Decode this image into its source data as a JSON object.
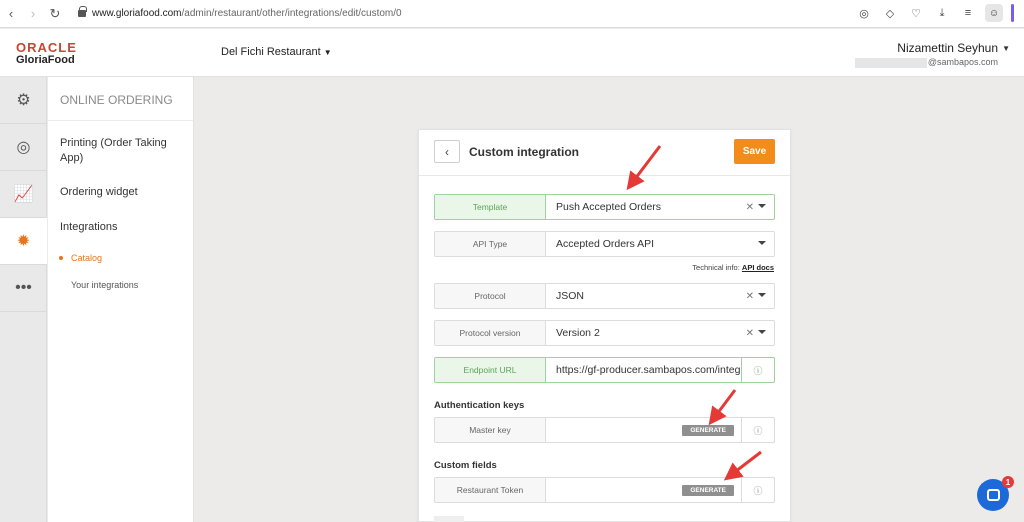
{
  "browser": {
    "url_domain": "www.gloriafood.com",
    "url_path": "/admin/restaurant/other/integrations/edit/custom/0"
  },
  "header": {
    "logo_top": "ORACLE",
    "logo_bottom": "GloriaFood",
    "restaurant": "Del Fichi Restaurant",
    "user_name": "Nizamettin Seyhun",
    "user_email": "@sambapos.com"
  },
  "rail": [
    "gears-icon",
    "target-icon",
    "chart-icon",
    "integrations-icon",
    "more-icon"
  ],
  "sidebar": {
    "heading": "ONLINE ORDERING",
    "printing": "Printing (Order Taking App)",
    "widget": "Ordering widget",
    "integrations": "Integrations",
    "catalog": "Catalog",
    "your_integrations": "Your integrations"
  },
  "panel": {
    "title": "Custom integration",
    "save": "Save",
    "template_label": "Template",
    "template_value": "Push Accepted Orders",
    "api_label": "API Type",
    "api_value": "Accepted Orders API",
    "tech_info": "Technical info:",
    "api_docs": "API docs",
    "protocol_label": "Protocol",
    "protocol_value": "JSON",
    "protver_label": "Protocol version",
    "protver_value": "Version 2",
    "endpoint_label": "Endpoint URL",
    "endpoint_value": "https://gf-producer.sambapos.com/integra",
    "auth_heading": "Authentication keys",
    "master_label": "Master key",
    "generate": "GENERATE",
    "custom_heading": "Custom fields",
    "token_label": "Restaurant Token"
  },
  "chat": {
    "badge": "1"
  },
  "colors": {
    "accent": "#f28c1a",
    "green": "#5ca35a",
    "arrow": "#e53935",
    "chat": "#1d69d8"
  }
}
